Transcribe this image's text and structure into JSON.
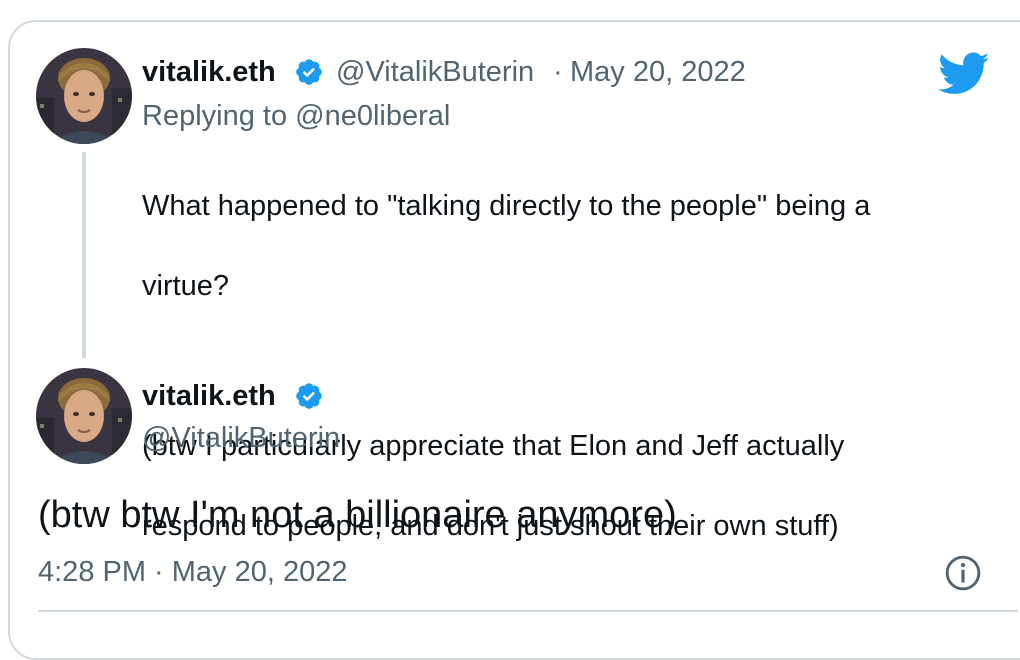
{
  "reply_tweet": {
    "display_name": "vitalik.eth",
    "handle": "@VitalikButerin",
    "separator": "·",
    "date": "May 20, 2022",
    "replying_to_prefix": "Replying to ",
    "replying_to_handle": "@ne0liberal",
    "text_line1": "What happened to \"talking directly to the people\" being a",
    "text_line2": "virtue?",
    "text_line3": "(btw I particularly appreciate that Elon and Jeff actually",
    "text_line4": "respond to people, and don't just shout their own stuff)"
  },
  "main_tweet": {
    "display_name": "vitalik.eth",
    "handle": "@VitalikButerin",
    "text": "(btw btw I'm not a billionaire anymore)",
    "timestamp": "4:28 PM · May 20, 2022"
  },
  "icons": {
    "brand": "twitter-bird-icon",
    "verified": "verified-badge-icon",
    "info": "info-icon"
  },
  "colors": {
    "brand_blue": "#1d9bf0",
    "secondary_text": "#536471",
    "primary_text": "#0f1419",
    "border": "#cfd9de"
  }
}
